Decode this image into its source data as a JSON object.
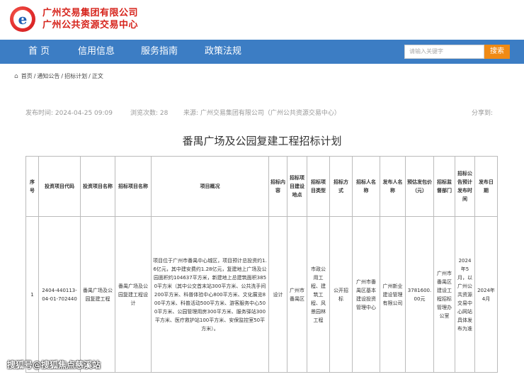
{
  "header": {
    "org_line1": "广州交易集团有限公司",
    "org_line2": "广州公共资源交易中心",
    "logo_letter": "e"
  },
  "nav": {
    "items": [
      "首 页",
      "信用信息",
      "服务指南",
      "政策法规"
    ],
    "search_placeholder": "请输入关键字",
    "search_button": "搜索"
  },
  "breadcrumb": {
    "home": "首页",
    "items": [
      "通知公告",
      "招标计划",
      "正文"
    ],
    "separator": "/"
  },
  "meta": {
    "publish_time": "发布时间: 2024-04-25 09:09",
    "views": "浏览次数: 28",
    "source": "来源: 广州交易集团有限公司（广州公共资源交易中心）",
    "share": "分享到:"
  },
  "article_title": "番禺广场及公园复建工程招标计划",
  "table": {
    "headers": [
      "序号",
      "投资项目代码",
      "投资项目名称",
      "招标项目名称",
      "项目概况",
      "招标内容",
      "招标项目建设地点",
      "招标项目类型",
      "招标方式",
      "招标人名称",
      "发布人名称",
      "预估发包价（元）",
      "招标监督部门",
      "招标公告预计发布时间",
      "发布日期"
    ],
    "row": {
      "no": "1",
      "code": "2404-440113-04-01-702440",
      "invest_name": "番禺广场及公园复建工程",
      "tender_name": "番禺广场及公园复建工程设计",
      "overview": "项目位于广州市番禺中心城区，项目预计总投资约1.6亿元，其中建安费约1.28亿元，复建地上广场及公园面积约104637平方米，新建地上总建筑面积3850平方米（其中公交首末站300平方米、公共洗手间200平方米、科普体验中心800平方米、文化展览800平方米、科普活动500平方米、游客服务中心500平方米、公园管理用房300平方米、服务驿站300平方米、医疗救护站100平方米、安保监控室50平方米）。",
      "content": "设计",
      "location": "广州市番禺区",
      "type": "市政公用工程、建筑工程、风景园林工程",
      "method": "公开招标",
      "tenderer": "广州市番禺区基本建设投资管理中心",
      "publisher": "广州新业建设管理有限公司",
      "price": "3781600.00元",
      "supervisor": "广州市番禺区建设工程招标管理办公室",
      "expected_time": "2024年5月，以广州公共资源交易中心网站具体发布为准",
      "publish_date": "2024年4月"
    }
  },
  "watermark": "搜狐号@搜狐焦点慈溪站"
}
